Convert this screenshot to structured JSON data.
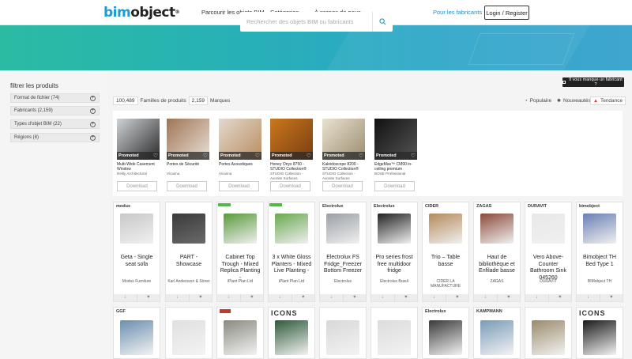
{
  "header": {
    "logo_bim": "bim",
    "logo_object": "object",
    "logo_reg": "®",
    "nav": [
      {
        "label": "Parcourir les objets BIM"
      },
      {
        "label": "Catégories"
      },
      {
        "label": "À propos de nous"
      }
    ],
    "manufacturers_link": "Pour les fabricants",
    "login_label": "Login / Register"
  },
  "search": {
    "placeholder": "Rechercher des objets BIM ou fabricants"
  },
  "sidebar": {
    "title": "filtrer les produits",
    "filters": [
      {
        "label": "Format de fichier (74)"
      },
      {
        "label": "Fabricants (2,159)"
      },
      {
        "label": "Types d'objet BIM (22)"
      },
      {
        "label": "Régions (8)"
      }
    ]
  },
  "toolbar": {
    "product_count": "100,489",
    "product_label": "Familles de produits",
    "brand_count": "2,159",
    "brand_label": "Marques",
    "missing_manufacturer": "Il vous manque un fabricant ?",
    "sort_popular": "Populaire",
    "sort_new": "Nouveautés",
    "sort_trend": "Tendance"
  },
  "promoted": [
    {
      "tag": "Promoted",
      "title": "Multi-Wide Casement Window",
      "brand": "Reilly Architectural",
      "download": "Download",
      "colors": [
        "#cfd3d6",
        "#2a2a2a"
      ]
    },
    {
      "tag": "Promoted",
      "title": "Portes de Sécurité",
      "brand": "Vicaima",
      "download": "Download",
      "colors": [
        "#a07453",
        "#e8e1d8"
      ]
    },
    {
      "tag": "Promoted",
      "title": "Portes Acoustiques",
      "brand": "Vicaima",
      "download": "Download",
      "colors": [
        "#e3d9ce",
        "#b98d60"
      ]
    },
    {
      "tag": "Promoted",
      "title": "Honey Onyx 8750 - STUDIO Collection®",
      "brand": "STUDIO Collection - Avonite Surfaces",
      "download": "Download",
      "colors": [
        "#c9781d",
        "#7a3d12"
      ]
    },
    {
      "tag": "Promoted",
      "title": "Kaleidoscope 8200 - STUDIO Collection®",
      "brand": "STUDIO Collection - Avonite Surfaces",
      "download": "Download",
      "colors": [
        "#e9e2d0",
        "#9c8c6e"
      ]
    },
    {
      "tag": "Promoted",
      "title": "EdgeMax™ CM90 in-ceiling premium",
      "brand": "BOSE Professional",
      "download": "Download",
      "colors": [
        "#111111",
        "#555555"
      ]
    }
  ],
  "products_row1": [
    {
      "logo": "modus",
      "title": "Geta - Single seat sofa",
      "brand": "Modus Furniture"
    },
    {
      "logo": "",
      "title": "PART - Showcase",
      "brand": "Karl Andersson & Söner"
    },
    {
      "logo": "",
      "title": "Cabinet Top Trough - Mixed Replica Planting -",
      "brand": "iPlant Plan Ltd"
    },
    {
      "logo": "",
      "title": "3 x White Gloss Planters - Mixed Live Planting -",
      "brand": "iPlant Plan Ltd"
    },
    {
      "logo": "Electrolux",
      "title": "Electrolux FS Fridge_Freezer Bottom Freezer",
      "brand": "Electrolux"
    },
    {
      "logo": "Electrolux",
      "title": "Pro series frost free multidoor fridge",
      "brand": "Electrolux Brasil"
    },
    {
      "logo": "CIDER",
      "title": "Trio – Table basse",
      "brand": "CIDER LA MANUFACTURE"
    },
    {
      "logo": "ZAGAS",
      "title": "Haut de bibliothèque et Enfilade basse",
      "brand": "ZAGAS"
    },
    {
      "logo": "DURAVIT",
      "title": "Vero Above-Counter Bathroom Sink 045260",
      "brand": "DURAVIT"
    },
    {
      "logo": "bimobject",
      "title": "Bimobject TH Bed Type 1",
      "brand": "BIMobject TH"
    }
  ],
  "products_row2": [
    {
      "logo": "GGF"
    },
    {
      "logo": ""
    },
    {
      "logo": ""
    },
    {
      "logo": "ICONS"
    },
    {
      "logo": ""
    },
    {
      "logo": ""
    },
    {
      "logo": "Electrolux"
    },
    {
      "logo": "KAMPMANN"
    },
    {
      "logo": ""
    },
    {
      "logo": "ICONS"
    }
  ]
}
